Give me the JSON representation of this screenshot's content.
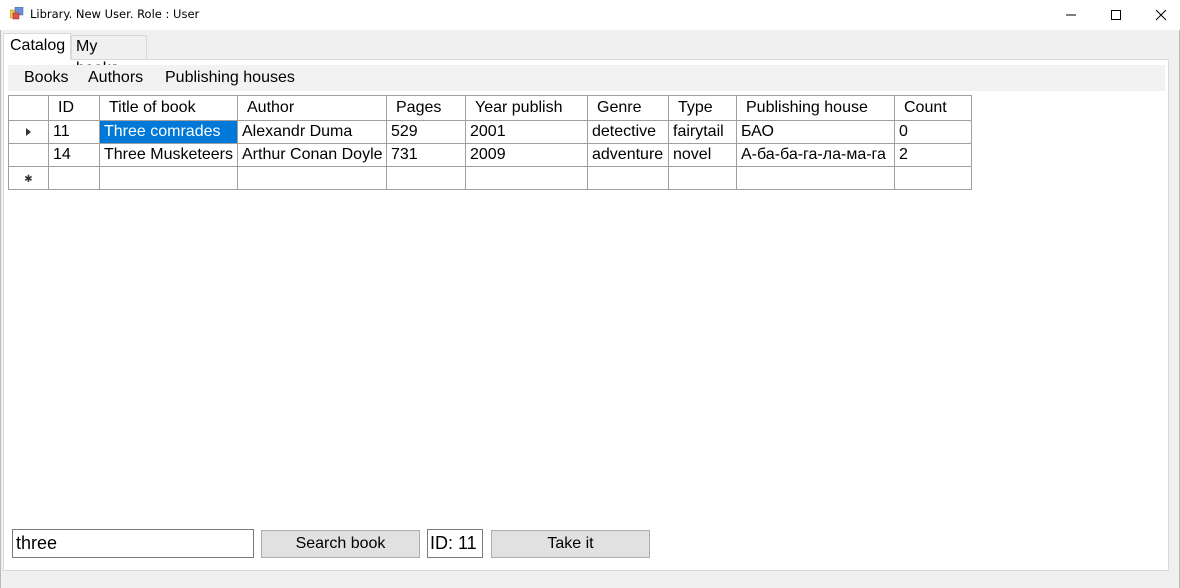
{
  "window": {
    "title": "Library. New User. Role : User",
    "controls": {
      "minimize": "minimize",
      "maximize": "maximize",
      "close": "close"
    }
  },
  "tabs": [
    {
      "label": "Catalog",
      "active": true
    },
    {
      "label": "My books",
      "active": false
    }
  ],
  "menu": {
    "items": [
      {
        "label": "Books"
      },
      {
        "label": "Authors"
      },
      {
        "label": "Publishing houses"
      }
    ]
  },
  "grid": {
    "columns": [
      "ID",
      "Title of book",
      "Author",
      "Pages",
      "Year publish",
      "Genre",
      "Type",
      "Publishing house",
      "Count"
    ],
    "rows": [
      {
        "indicator": "current",
        "cells": [
          "11",
          "Three comrades",
          "Alexandr Duma",
          "529",
          "2001",
          "detective",
          "fairytail",
          "БАО",
          "0"
        ]
      },
      {
        "indicator": "",
        "cells": [
          "14",
          "Three Musketeers",
          "Arthur Conan Doyle",
          "731",
          "2009",
          "adventure",
          "novel",
          "А-ба-ба-га-ла-ма-га",
          "2"
        ]
      },
      {
        "indicator": "new",
        "cells": [
          "",
          "",
          "",
          "",
          "",
          "",
          "",
          "",
          ""
        ]
      }
    ],
    "selected_cell": {
      "row": 0,
      "column": 1
    }
  },
  "controls": {
    "search_value": "three",
    "search_button": "Search book",
    "id_label": "ID: 11",
    "take_button": "Take it"
  }
}
